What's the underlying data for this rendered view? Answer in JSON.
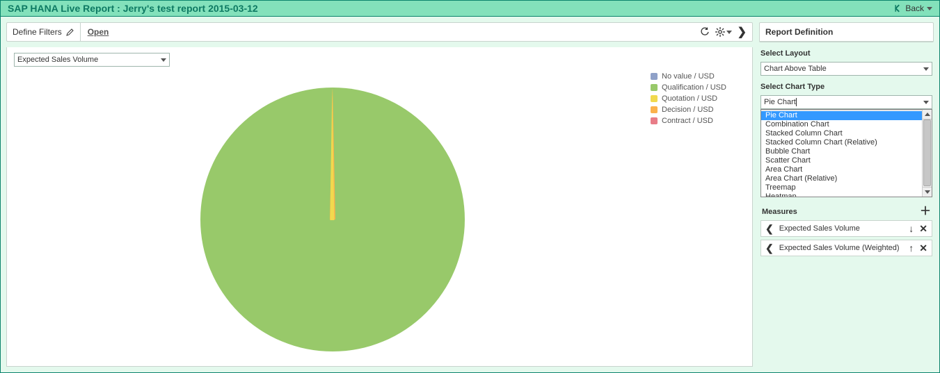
{
  "header": {
    "title": "SAP HANA Live Report : Jerry's test report 2015-03-12",
    "back_label": "Back"
  },
  "toolbar": {
    "define_filters_label": "Define Filters",
    "open_label": "Open"
  },
  "chart": {
    "measure_selector": "Expected Sales Volume"
  },
  "chart_data": {
    "type": "pie",
    "title": "",
    "series": [
      {
        "name": "No value / USD",
        "value": 0,
        "color": "#8fa1c8"
      },
      {
        "name": "Qualification / USD",
        "value": 98,
        "color": "#98c96a"
      },
      {
        "name": "Quotation / USD",
        "value": 0.5,
        "color": "#f1d94e"
      },
      {
        "name": "Decision / USD",
        "value": 1.5,
        "color": "#fbb24c"
      },
      {
        "name": "Contract / USD",
        "value": 0,
        "color": "#e87d88"
      }
    ]
  },
  "legend": [
    {
      "label": "No value / USD",
      "color": "#8fa1c8"
    },
    {
      "label": "Qualification / USD",
      "color": "#98c96a"
    },
    {
      "label": "Quotation / USD",
      "color": "#f1d94e"
    },
    {
      "label": "Decision / USD",
      "color": "#fbb24c"
    },
    {
      "label": "Contract / USD",
      "color": "#e87d88"
    }
  ],
  "sidebar": {
    "panel_title": "Report Definition",
    "layout_title": "Select Layout",
    "layout_value": "Chart Above Table",
    "chart_type_title": "Select Chart Type",
    "chart_type_value": "Pie Chart",
    "chart_type_input": "Pie Chart",
    "chart_type_options": [
      "Pie Chart",
      "Combination Chart",
      "Stacked Column Chart",
      "Stacked Column Chart (Relative)",
      "Bubble Chart",
      "Scatter Chart",
      "Area Chart",
      "Area Chart (Relative)",
      "Treemap",
      "Heatmap"
    ],
    "measures_title": "Measures",
    "measures": [
      "Expected Sales Volume",
      "Expected Sales Volume (Weighted)"
    ]
  }
}
